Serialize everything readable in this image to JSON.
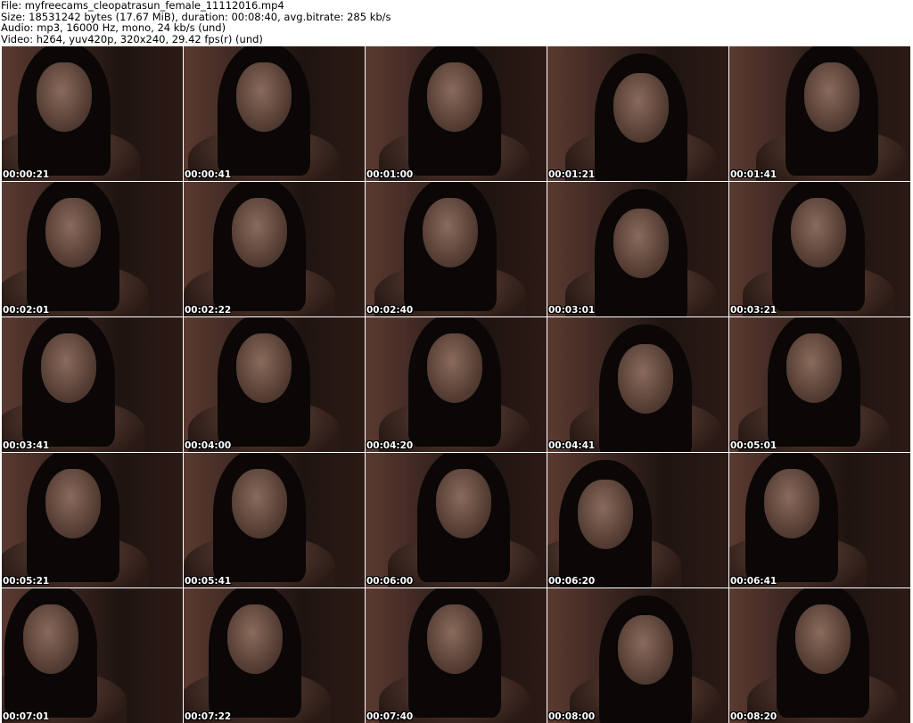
{
  "header": {
    "line1": "File: myfreecams_cleopatrasun_female_11112016.mp4",
    "line2": "Size: 18531242 bytes (17.67 MiB), duration: 00:08:40, avg.bitrate: 285 kb/s",
    "line3": "Audio: mp3, 16000 Hz, mono, 24 kb/s (und)",
    "line4": "Video: h264, yuv420p, 320x240, 29.42 fps(r) (und)"
  },
  "thumbnails": [
    {
      "time": "00:00:21"
    },
    {
      "time": "00:00:41"
    },
    {
      "time": "00:01:00"
    },
    {
      "time": "00:01:21"
    },
    {
      "time": "00:01:41"
    },
    {
      "time": "00:02:01"
    },
    {
      "time": "00:02:22"
    },
    {
      "time": "00:02:40"
    },
    {
      "time": "00:03:01"
    },
    {
      "time": "00:03:21"
    },
    {
      "time": "00:03:41"
    },
    {
      "time": "00:04:00"
    },
    {
      "time": "00:04:20"
    },
    {
      "time": "00:04:41"
    },
    {
      "time": "00:05:01"
    },
    {
      "time": "00:05:21"
    },
    {
      "time": "00:05:41"
    },
    {
      "time": "00:06:00"
    },
    {
      "time": "00:06:20"
    },
    {
      "time": "00:06:41"
    },
    {
      "time": "00:07:01"
    },
    {
      "time": "00:07:22"
    },
    {
      "time": "00:07:40"
    },
    {
      "time": "00:08:00"
    },
    {
      "time": "00:08:20"
    }
  ]
}
